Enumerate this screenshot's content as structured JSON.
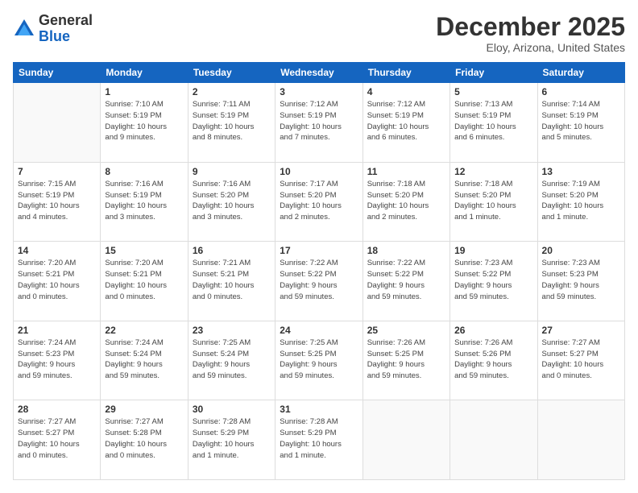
{
  "header": {
    "logo_general": "General",
    "logo_blue": "Blue",
    "month_title": "December 2025",
    "location": "Eloy, Arizona, United States"
  },
  "weekdays": [
    "Sunday",
    "Monday",
    "Tuesday",
    "Wednesday",
    "Thursday",
    "Friday",
    "Saturday"
  ],
  "weeks": [
    [
      {
        "day": "",
        "info": ""
      },
      {
        "day": "1",
        "info": "Sunrise: 7:10 AM\nSunset: 5:19 PM\nDaylight: 10 hours\nand 9 minutes."
      },
      {
        "day": "2",
        "info": "Sunrise: 7:11 AM\nSunset: 5:19 PM\nDaylight: 10 hours\nand 8 minutes."
      },
      {
        "day": "3",
        "info": "Sunrise: 7:12 AM\nSunset: 5:19 PM\nDaylight: 10 hours\nand 7 minutes."
      },
      {
        "day": "4",
        "info": "Sunrise: 7:12 AM\nSunset: 5:19 PM\nDaylight: 10 hours\nand 6 minutes."
      },
      {
        "day": "5",
        "info": "Sunrise: 7:13 AM\nSunset: 5:19 PM\nDaylight: 10 hours\nand 6 minutes."
      },
      {
        "day": "6",
        "info": "Sunrise: 7:14 AM\nSunset: 5:19 PM\nDaylight: 10 hours\nand 5 minutes."
      }
    ],
    [
      {
        "day": "7",
        "info": "Sunrise: 7:15 AM\nSunset: 5:19 PM\nDaylight: 10 hours\nand 4 minutes."
      },
      {
        "day": "8",
        "info": "Sunrise: 7:16 AM\nSunset: 5:19 PM\nDaylight: 10 hours\nand 3 minutes."
      },
      {
        "day": "9",
        "info": "Sunrise: 7:16 AM\nSunset: 5:20 PM\nDaylight: 10 hours\nand 3 minutes."
      },
      {
        "day": "10",
        "info": "Sunrise: 7:17 AM\nSunset: 5:20 PM\nDaylight: 10 hours\nand 2 minutes."
      },
      {
        "day": "11",
        "info": "Sunrise: 7:18 AM\nSunset: 5:20 PM\nDaylight: 10 hours\nand 2 minutes."
      },
      {
        "day": "12",
        "info": "Sunrise: 7:18 AM\nSunset: 5:20 PM\nDaylight: 10 hours\nand 1 minute."
      },
      {
        "day": "13",
        "info": "Sunrise: 7:19 AM\nSunset: 5:20 PM\nDaylight: 10 hours\nand 1 minute."
      }
    ],
    [
      {
        "day": "14",
        "info": "Sunrise: 7:20 AM\nSunset: 5:21 PM\nDaylight: 10 hours\nand 0 minutes."
      },
      {
        "day": "15",
        "info": "Sunrise: 7:20 AM\nSunset: 5:21 PM\nDaylight: 10 hours\nand 0 minutes."
      },
      {
        "day": "16",
        "info": "Sunrise: 7:21 AM\nSunset: 5:21 PM\nDaylight: 10 hours\nand 0 minutes."
      },
      {
        "day": "17",
        "info": "Sunrise: 7:22 AM\nSunset: 5:22 PM\nDaylight: 9 hours\nand 59 minutes."
      },
      {
        "day": "18",
        "info": "Sunrise: 7:22 AM\nSunset: 5:22 PM\nDaylight: 9 hours\nand 59 minutes."
      },
      {
        "day": "19",
        "info": "Sunrise: 7:23 AM\nSunset: 5:22 PM\nDaylight: 9 hours\nand 59 minutes."
      },
      {
        "day": "20",
        "info": "Sunrise: 7:23 AM\nSunset: 5:23 PM\nDaylight: 9 hours\nand 59 minutes."
      }
    ],
    [
      {
        "day": "21",
        "info": "Sunrise: 7:24 AM\nSunset: 5:23 PM\nDaylight: 9 hours\nand 59 minutes."
      },
      {
        "day": "22",
        "info": "Sunrise: 7:24 AM\nSunset: 5:24 PM\nDaylight: 9 hours\nand 59 minutes."
      },
      {
        "day": "23",
        "info": "Sunrise: 7:25 AM\nSunset: 5:24 PM\nDaylight: 9 hours\nand 59 minutes."
      },
      {
        "day": "24",
        "info": "Sunrise: 7:25 AM\nSunset: 5:25 PM\nDaylight: 9 hours\nand 59 minutes."
      },
      {
        "day": "25",
        "info": "Sunrise: 7:26 AM\nSunset: 5:25 PM\nDaylight: 9 hours\nand 59 minutes."
      },
      {
        "day": "26",
        "info": "Sunrise: 7:26 AM\nSunset: 5:26 PM\nDaylight: 9 hours\nand 59 minutes."
      },
      {
        "day": "27",
        "info": "Sunrise: 7:27 AM\nSunset: 5:27 PM\nDaylight: 10 hours\nand 0 minutes."
      }
    ],
    [
      {
        "day": "28",
        "info": "Sunrise: 7:27 AM\nSunset: 5:27 PM\nDaylight: 10 hours\nand 0 minutes."
      },
      {
        "day": "29",
        "info": "Sunrise: 7:27 AM\nSunset: 5:28 PM\nDaylight: 10 hours\nand 0 minutes."
      },
      {
        "day": "30",
        "info": "Sunrise: 7:28 AM\nSunset: 5:29 PM\nDaylight: 10 hours\nand 1 minute."
      },
      {
        "day": "31",
        "info": "Sunrise: 7:28 AM\nSunset: 5:29 PM\nDaylight: 10 hours\nand 1 minute."
      },
      {
        "day": "",
        "info": ""
      },
      {
        "day": "",
        "info": ""
      },
      {
        "day": "",
        "info": ""
      }
    ]
  ]
}
